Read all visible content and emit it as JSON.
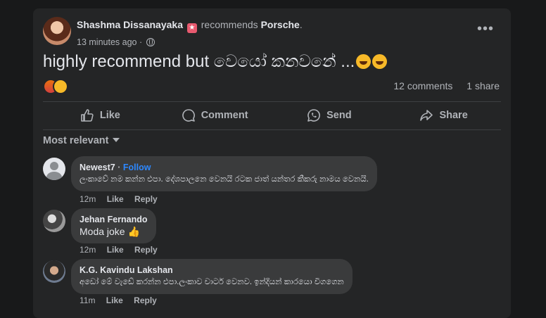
{
  "post": {
    "author": "Shashma Dissanayaka",
    "badge_icon": "top-fan-badge-icon",
    "verb": "recommends",
    "page": "Porsche",
    "time": "13 minutes ago",
    "privacy_icon": "globe-icon",
    "text": "highly recommend but වෙයෝ කනවනේ ...",
    "reactions": [
      "angry",
      "haha"
    ],
    "comments_count": "12 comments",
    "shares_count": "1 share"
  },
  "actions": {
    "like": "Like",
    "comment": "Comment",
    "send": "Send",
    "share": "Share"
  },
  "sort": {
    "label": "Most relevant"
  },
  "comments": [
    {
      "name": "Newest7",
      "follow_sep": "·",
      "follow": "Follow",
      "text": "ලංකාවේ නම කන්න එපා. දේශපාලනෙ වෙනයි රටක ජාත් යන්තර කීකරු නාමය වෙනයි.",
      "time": "12m",
      "like": "Like",
      "reply": "Reply"
    },
    {
      "name": "Jehan Fernando",
      "text": "Moda joke 👍",
      "time": "12m",
      "like": "Like",
      "reply": "Reply"
    },
    {
      "name": "K.G. Kavindu Lakshan",
      "text": "අඩෝ මේ වැඩේ කරන්න එපා.ලංකාව චාටර් වෙනව. ඉන්දියන් කාරයො විගගෙන",
      "time": "11m",
      "like": "Like",
      "reply": "Reply"
    }
  ]
}
